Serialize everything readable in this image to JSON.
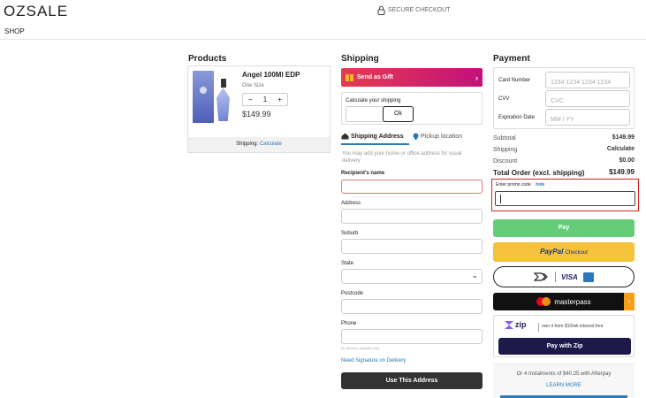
{
  "header": {
    "logo": "OZSALE",
    "secure_label": "SECURE CHECKOUT",
    "shop_label": "SHOP"
  },
  "products": {
    "heading": "Products",
    "item": {
      "name": "Angel 100Ml EDP",
      "size": "One Size",
      "quantity": "1",
      "minus": "−",
      "plus": "+",
      "price": "$149.99"
    },
    "shipping_label": "Shipping:",
    "shipping_link": "Calculate"
  },
  "shipping": {
    "heading": "Shipping",
    "gift_label": "Send as Gift",
    "calc_label": "Calculate your shipping",
    "ok_label": "Ok",
    "tab_address": "Shipping Address",
    "tab_pickup": "Pickup location",
    "help_text": "You may add your home or office address for usual delivery",
    "fields": {
      "recipient": "Recipient's name",
      "address": "Address",
      "suburb": "Suburb",
      "state": "State",
      "postcode": "Postcode",
      "phone": "Phone"
    },
    "phone_note": "for delivery updates only",
    "signature_link": "Need Signature on Delivery",
    "use_address_button": "Use This Address"
  },
  "payment": {
    "heading": "Payment",
    "card_number_label": "Card Number",
    "card_number_placeholder": "1234 1234 1234 1234",
    "cvv_label": "CVV",
    "cvv_placeholder": "CVC",
    "expiry_label": "Expiration Date",
    "expiry_placeholder": "MM / YY",
    "subtotal_label": "Subtotal",
    "subtotal_value": "$149.99",
    "shipping_label": "Shipping",
    "shipping_value": "Calculate",
    "discount_label": "Discount",
    "discount_value": "$0.00",
    "total_label": "Total Order (excl. shipping)",
    "total_value": "$149.99",
    "promo_label": "Enter promo code",
    "promo_hide": "hide",
    "pay_button": "Pay",
    "paypal_word": "PayPal",
    "paypal_suffix": "Checkout",
    "visa_word": "VISA",
    "masterpass_word": "masterpass",
    "zip_word": "zip",
    "zip_text": "own it from $10/wk interest free",
    "zip_button": "Pay with Zip",
    "afterpay_text": "Or 4 Instalments of $40.25 with Afterpay",
    "afterpay_link": "LEARN MORE"
  },
  "colors": {
    "accent_blue": "#2a7ab8",
    "gift_gradient_start": "#f0a12a",
    "gift_gradient_end": "#c2117a",
    "pay_green": "#66cc78",
    "paypal_yellow": "#f5c23b",
    "promo_border": "#d0261d",
    "zip_navy": "#1d1a4a"
  }
}
